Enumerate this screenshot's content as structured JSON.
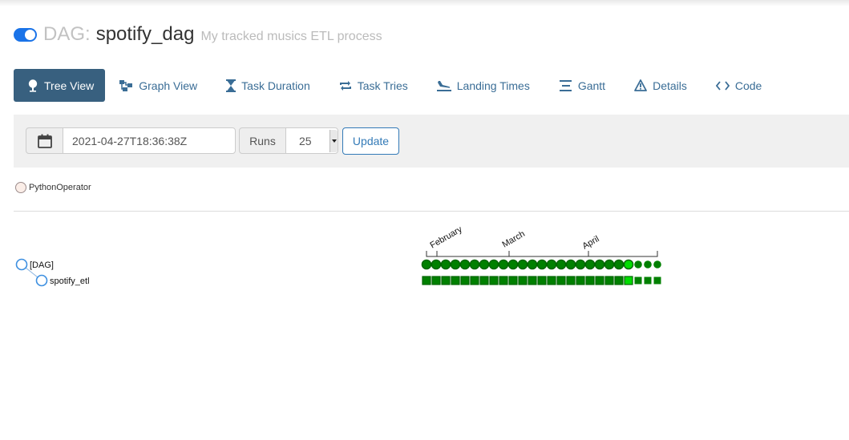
{
  "header": {
    "prefix": "DAG:",
    "dag_id": "spotify_dag",
    "description": "My tracked musics ETL process",
    "paused_toggle": "on"
  },
  "nav": [
    {
      "label": "Tree View",
      "icon": "tree-icon",
      "active": true
    },
    {
      "label": "Graph View",
      "icon": "graph-icon",
      "active": false
    },
    {
      "label": "Task Duration",
      "icon": "hourglass-icon",
      "active": false
    },
    {
      "label": "Task Tries",
      "icon": "repeat-icon",
      "active": false
    },
    {
      "label": "Landing Times",
      "icon": "plane-landing-icon",
      "active": false
    },
    {
      "label": "Gantt",
      "icon": "gantt-icon",
      "active": false
    },
    {
      "label": "Details",
      "icon": "warning-triangle-icon",
      "active": false
    },
    {
      "label": "Code",
      "icon": "code-icon",
      "active": false
    }
  ],
  "form": {
    "base_date": "2021-04-27T18:36:38Z",
    "runs_label": "Runs",
    "runs_value": "25",
    "update_label": "Update"
  },
  "legend": {
    "operator": "PythonOperator",
    "color": "#ffefeb"
  },
  "tree": {
    "root_label": "[DAG]",
    "task_label": "spotify_etl",
    "month_labels": [
      "February",
      "March",
      "April"
    ],
    "run_count": 25,
    "highlight_index": 21,
    "colors": {
      "success": "#008000",
      "success_dark": "#006400",
      "highlight": "#00dd00"
    }
  }
}
